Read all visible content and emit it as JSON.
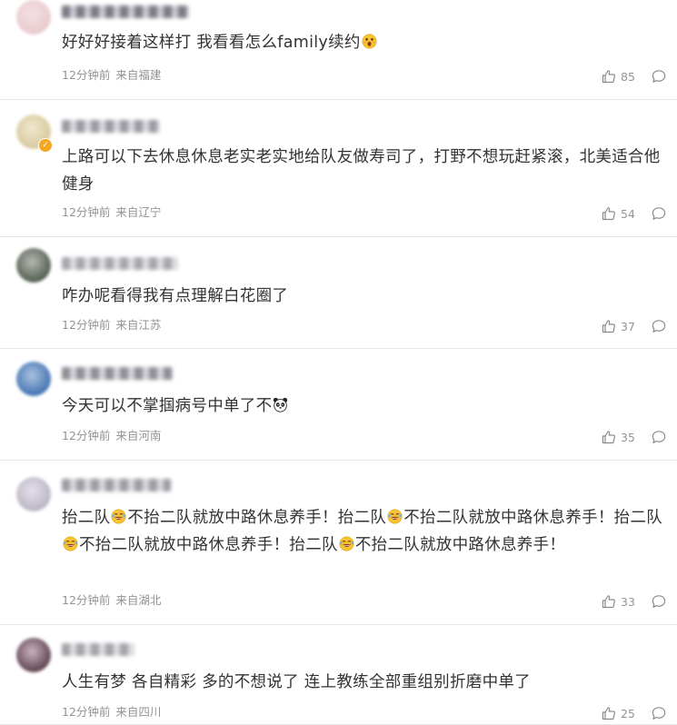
{
  "comments": [
    {
      "avatar_colors": [
        "#e8c8cc",
        "#f3e1e3"
      ],
      "username_colors": [
        "#7b7b85",
        "#c9c9cf"
      ],
      "username_width": 140,
      "text_parts": [
        {
          "t": "好好好接着这样打 我看看怎么family续约"
        },
        {
          "emoji": "surprised-emoji-icon"
        }
      ],
      "time": "12分钟前",
      "location": "来自福建",
      "likes": "85"
    },
    {
      "avatar_colors": [
        "#d6c89a",
        "#efe7cf"
      ],
      "vip": true,
      "username_colors": [
        "#9a9aa2",
        "#d9d9de"
      ],
      "username_width": 108,
      "text_parts": [
        {
          "t": "上路可以下去休息休息老实老实地给队友做寿司了，打野不想玩赶紧滚，北美适合他健身"
        }
      ],
      "time": "12分钟前",
      "location": "来自辽宁",
      "likes": "54"
    },
    {
      "avatar_colors": [
        "#4e5b4c",
        "#b7b7b3"
      ],
      "username_colors": [
        "#a6a6ac",
        "#dcdce0"
      ],
      "username_width": 128,
      "text_parts": [
        {
          "t": "咋办呢看得我有点理解白花圈了"
        }
      ],
      "time": "12分钟前",
      "location": "来自江苏",
      "likes": "37"
    },
    {
      "avatar_colors": [
        "#3e6fb0",
        "#a9c2dd"
      ],
      "username_colors": [
        "#8d8d95",
        "#d3d3d8"
      ],
      "username_width": 122,
      "text_parts": [
        {
          "t": "今天可以不掌掴病号中单了不"
        },
        {
          "emoji": "panda-emoji-icon"
        }
      ],
      "time": "12分钟前",
      "location": "来自河南",
      "likes": "35"
    },
    {
      "avatar_colors": [
        "#b8b3c2",
        "#e4e0ea"
      ],
      "username_colors": [
        "#9c9ca3",
        "#d7d7dc"
      ],
      "username_width": 120,
      "text_parts": [
        {
          "t": "抬二队"
        },
        {
          "emoji": "laughing-emoji-icon"
        },
        {
          "t": "不抬二队就放中路休息养手！抬二队"
        },
        {
          "emoji": "laughing-emoji-icon"
        },
        {
          "t": "不抬二队就放中路休息养手！抬二队"
        },
        {
          "emoji": "laughing-emoji-icon"
        },
        {
          "t": "不抬二队就放中路休息养手！抬二队"
        },
        {
          "emoji": "laughing-emoji-icon"
        },
        {
          "t": "不抬二队就放中路休息养手！"
        }
      ],
      "time": "12分钟前",
      "location": "来自湖北",
      "likes": "33"
    },
    {
      "avatar_colors": [
        "#5a3f4d",
        "#c9b2bd"
      ],
      "username_colors": [
        "#a3a3aa",
        "#dcdce0"
      ],
      "username_width": 80,
      "text_parts": [
        {
          "t": "人生有梦 各自精彩 多的不想说了 连上教练全部重组别折磨中单了"
        }
      ],
      "time": "12分钟前",
      "location": "来自四川",
      "likes": "25"
    }
  ],
  "icons": {
    "like": "thumbs-up-icon",
    "reply": "comment-bubble-icon"
  },
  "colors": {
    "text": "#333333",
    "meta": "#939393",
    "divider": "#e6e6e6"
  }
}
